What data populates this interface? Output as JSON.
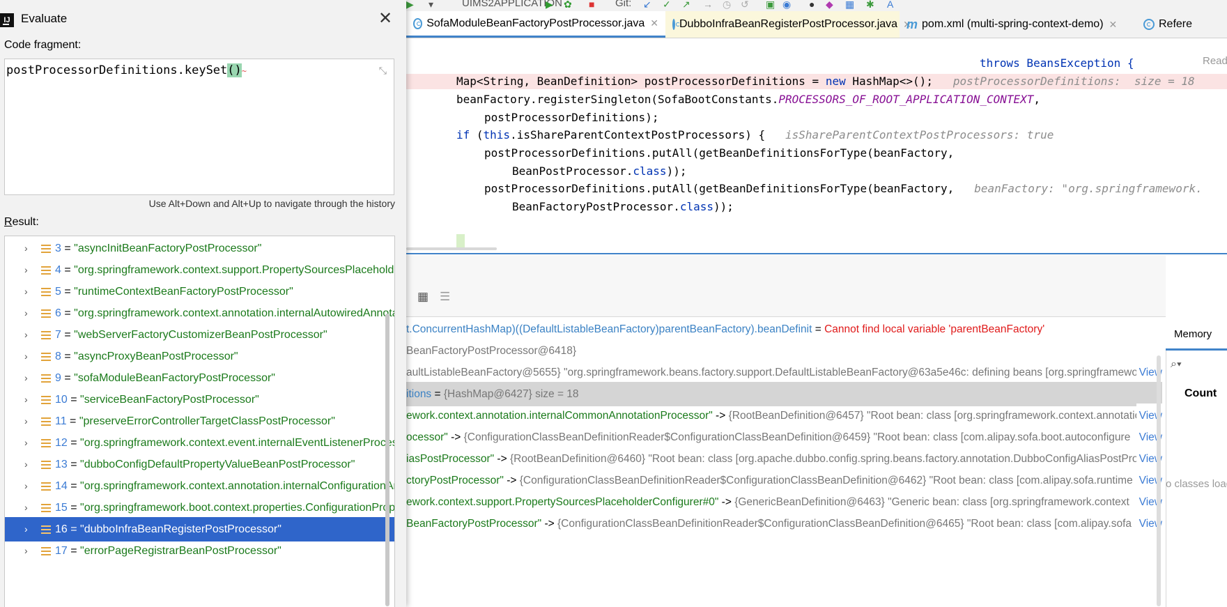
{
  "toolbar": {
    "run_config": "UIMS2APPLICATION",
    "git_label": "Git:"
  },
  "tabs": [
    {
      "label": "SofaModuleBeanFactoryPostProcessor.java"
    },
    {
      "label": "DubboInfraBeanRegisterPostProcessor.java"
    },
    {
      "label": "pom.xml (multi-spring-context-demo)"
    },
    {
      "label": "Refere"
    }
  ],
  "editor": {
    "line0": "throws BeansException {",
    "line1_code": "Map<String, BeanDefinition> postProcessorDefinitions = ",
    "line1_new": "new",
    "line1_rest": " HashMap<>();",
    "line1_hint": "postProcessorDefinitions:  size = 18",
    "line2_code": "beanFactory.registerSingleton(SofaBootConstants.",
    "line2_const": "PROCESSORS_OF_ROOT_APPLICATION_CONTEXT",
    "line2_end": ",",
    "line3": "postProcessorDefinitions);",
    "line4_if": "if",
    "line4_paren": " (",
    "line4_this": "this",
    "line4_rest": ".isShareParentContextPostProcessors) {",
    "line4_hint": "isShareParentContextPostProcessors: true",
    "line5": "postProcessorDefinitions.putAll(getBeanDefinitionsForType(beanFactory,",
    "line6_a": "BeanPostProcessor.",
    "line6_class": "class",
    "line6_b": "));",
    "line7": "postProcessorDefinitions.putAll(getBeanDefinitionsForType(beanFactory,",
    "line7_hint": "beanFactory: \"org.springframework.",
    "line8_a": "BeanFactoryPostProcessor.",
    "line8_class": "class",
    "line8_b": "));",
    "read_label": "Read"
  },
  "variables": [
    {
      "name": "t.ConcurrentHashMap)((DefaultListableBeanFactory)parentBeanFactory).beanDefinit",
      "eq": " = ",
      "value": "Cannot find local variable 'parentBeanFactory'",
      "view": ""
    },
    {
      "name": "",
      "eq": "",
      "value": "BeanFactoryPostProcessor@6418}",
      "view": ""
    },
    {
      "name": "",
      "eq": "",
      "value": "aultListableBeanFactory@5655} \"org.springframework.beans.factory.support.DefaultListableBeanFactory@63a5e46c: defining beans [org.springframework",
      "view": "View"
    },
    {
      "name": "itions",
      "eq": " = ",
      "value": "{HashMap@6427}  size = 18",
      "view": ""
    },
    {
      "name": "ework.context.annotation.internalCommonAnnotationProcessor\"",
      "eq": " -> ",
      "value": "{RootBeanDefinition@6457} \"Root bean: class [org.springframework.context.annotation",
      "view": "View"
    },
    {
      "name": "ocessor\"",
      "eq": " -> ",
      "value": "{ConfigurationClassBeanDefinitionReader$ConfigurationClassBeanDefinition@6459} \"Root bean: class [com.alipay.sofa.boot.autoconfigure",
      "view": "View"
    },
    {
      "name": "iasPostProcessor\"",
      "eq": " -> ",
      "value": "{RootBeanDefinition@6460} \"Root bean: class [org.apache.dubbo.config.spring.beans.factory.annotation.DubboConfigAliasPostProcessor",
      "view": "View"
    },
    {
      "name": "ctoryPostProcessor\"",
      "eq": " -> ",
      "value": "{ConfigurationClassBeanDefinitionReader$ConfigurationClassBeanDefinition@6462} \"Root bean: class [com.alipay.sofa.runtime",
      "view": "View"
    },
    {
      "name": "ework.context.support.PropertySourcesPlaceholderConfigurer#0\"",
      "eq": " -> ",
      "value": "{GenericBeanDefinition@6463} \"Generic bean: class [org.springframework.context",
      "view": "View"
    },
    {
      "name": "BeanFactoryPostProcessor\"",
      "eq": " -> ",
      "value": "{ConfigurationClassBeanDefinitionReader$ConfigurationClassBeanDefinition@6465} \"Root bean: class [com.alipay.sofa",
      "view": "View"
    }
  ],
  "memory": {
    "tab": "Memory",
    "count_header": "Count",
    "empty": "o classes load"
  },
  "dialog": {
    "title": "Evaluate",
    "fragment_label": "Code fragment:",
    "fragment_code": "postProcessorDefinitions.keySet",
    "fragment_paren": "()",
    "history_hint": "Use Alt+Down and Alt+Up to navigate through the history",
    "result_label_u": "R",
    "result_label_rest": "esult:",
    "results": [
      {
        "index": "3",
        "value": "\"asyncInitBeanFactoryPostProcessor\""
      },
      {
        "index": "4",
        "value": "\"org.springframework.context.support.PropertySourcesPlaceholderConfigurer\""
      },
      {
        "index": "5",
        "value": "\"runtimeContextBeanFactoryPostProcessor\""
      },
      {
        "index": "6",
        "value": "\"org.springframework.context.annotation.internalAutowiredAnnotationProcessor\""
      },
      {
        "index": "7",
        "value": "\"webServerFactoryCustomizerBeanPostProcessor\""
      },
      {
        "index": "8",
        "value": "\"asyncProxyBeanPostProcessor\""
      },
      {
        "index": "9",
        "value": "\"sofaModuleBeanFactoryPostProcessor\""
      },
      {
        "index": "10",
        "value": "\"serviceBeanFactoryPostProcessor\""
      },
      {
        "index": "11",
        "value": "\"preserveErrorControllerTargetClassPostProcessor\""
      },
      {
        "index": "12",
        "value": "\"org.springframework.context.event.internalEventListenerProcessor\""
      },
      {
        "index": "13",
        "value": "\"dubboConfigDefaultPropertyValueBeanPostProcessor\""
      },
      {
        "index": "14",
        "value": "\"org.springframework.context.annotation.internalConfigurationAnnotationProcessor\""
      },
      {
        "index": "15",
        "value": "\"org.springframework.boot.context.properties.ConfigurationPropertiesBeanDefinitionValidator\""
      },
      {
        "index": "16",
        "value": "\"dubboInfraBeanRegisterPostProcessor\""
      },
      {
        "index": "17",
        "value": "\"errorPageRegistrarBeanPostProcessor\""
      }
    ],
    "selected_index": "16"
  }
}
